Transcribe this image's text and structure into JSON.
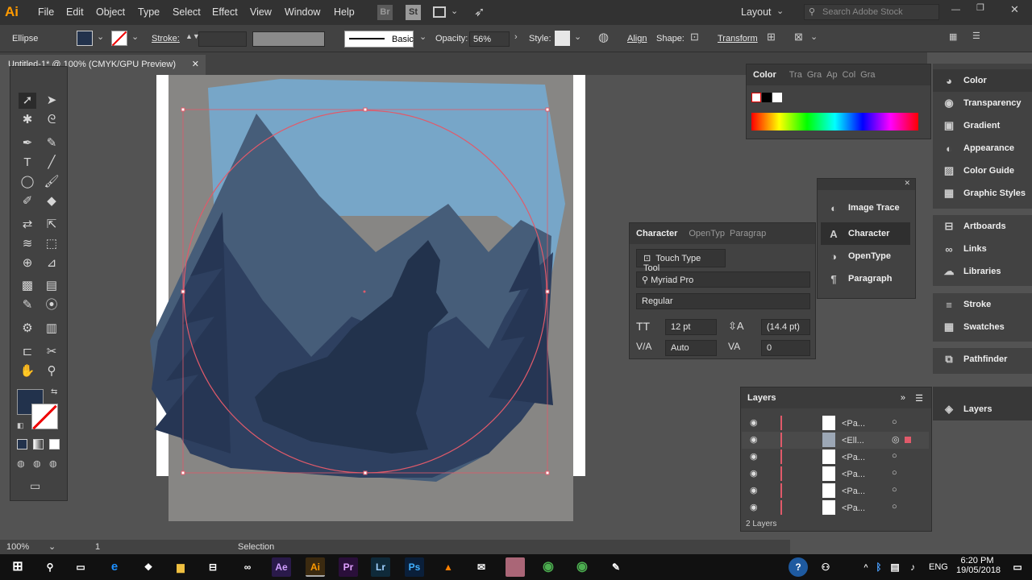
{
  "app": {
    "logo": "Ai",
    "workspace": "Layout",
    "search_placeholder": "Search Adobe Stock"
  },
  "menu": [
    "File",
    "Edit",
    "Object",
    "Type",
    "Select",
    "Effect",
    "View",
    "Window",
    "Help"
  ],
  "menu_icons": {
    "bridge": "Br",
    "stock": "St"
  },
  "control": {
    "object_type": "Ellipse",
    "stroke_label": "Stroke:",
    "brush": "Basic",
    "opacity_label": "Opacity:",
    "opacity_value": "56%",
    "style_label": "Style:",
    "align_label": "Align",
    "shape_label": "Shape:",
    "transform_label": "Transform"
  },
  "document_tab": {
    "title": "Untitled-1* @ 100% (CMYK/GPU Preview)",
    "close": "✕"
  },
  "colors": {
    "fill": "#22324c",
    "artboard": "#ffffff",
    "sky": "#77a6c8",
    "circle_outline": "#e05a6a"
  },
  "color_panel": {
    "tabs": [
      "Color",
      "Tra",
      "Gra",
      "Ap",
      "Col",
      "Gra"
    ]
  },
  "character_panel": {
    "tabs": [
      "Character",
      "OpenTyp",
      "Paragrap"
    ],
    "touch_type": "Touch Type Tool",
    "font_family": "Myriad Pro",
    "font_style": "Regular",
    "font_size": "12 pt",
    "leading": "(14.4 pt)",
    "kerning": "Auto",
    "tracking": "0"
  },
  "float_panel": {
    "items": [
      "Image Trace",
      "Character",
      "OpenType",
      "Paragraph"
    ]
  },
  "dock": {
    "group1": [
      "Color",
      "Transparency",
      "Gradient",
      "Appearance",
      "Color Guide",
      "Graphic Styles"
    ],
    "group2": [
      "Artboards",
      "Links",
      "Libraries"
    ],
    "group3": [
      "Stroke",
      "Swatches"
    ],
    "group4": [
      "Pathfinder"
    ],
    "group5": [
      "Layers"
    ]
  },
  "layers_panel": {
    "title": "Layers",
    "rows": [
      "<Pa...",
      "<Ell...",
      "<Pa...",
      "<Pa...",
      "<Pa...",
      "<Pa..."
    ],
    "footer": "2 Layers"
  },
  "status": {
    "zoom": "100%",
    "artboard": "1",
    "tool": "Selection"
  },
  "taskbar": {
    "time": "6:20 PM",
    "date": "19/05/2018",
    "lang": "ENG"
  }
}
